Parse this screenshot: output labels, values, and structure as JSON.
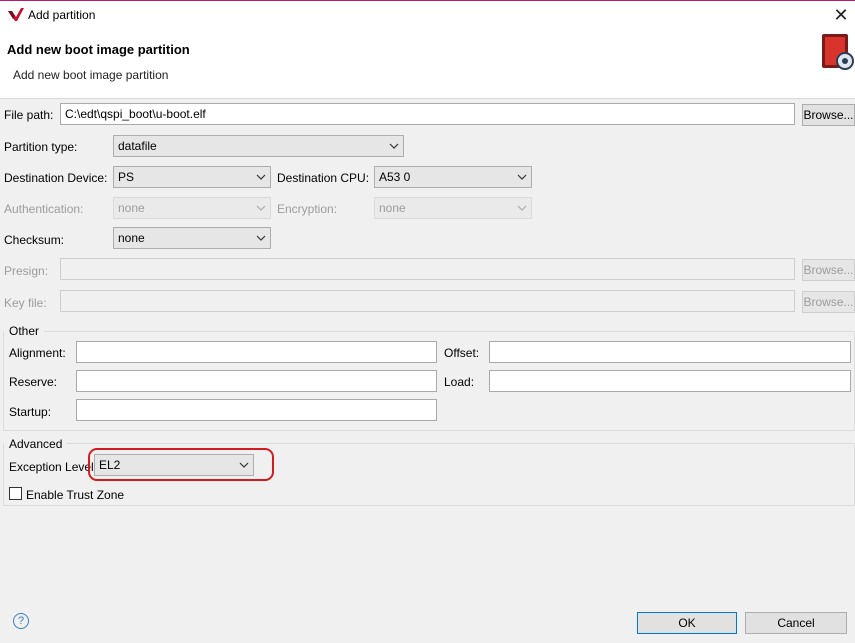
{
  "window": {
    "title": "Add partition",
    "close_label": "✕"
  },
  "header": {
    "title": "Add new boot image partition",
    "subtitle": "Add new boot image partition"
  },
  "file_path": {
    "label": "File path:",
    "value": "C:\\edt\\qspi_boot\\u-boot.elf",
    "browse_label": "Browse..."
  },
  "partition_type": {
    "label": "Partition type:",
    "value": "datafile"
  },
  "destination_device": {
    "label": "Destination Device:",
    "value": "PS"
  },
  "destination_cpu": {
    "label": "Destination CPU:",
    "value": "A53 0"
  },
  "authentication": {
    "label": "Authentication:",
    "value": "none"
  },
  "encryption": {
    "label": "Encryption:",
    "value": "none"
  },
  "checksum": {
    "label": "Checksum:",
    "value": "none"
  },
  "presign": {
    "label": "Presign:",
    "value": "",
    "browse_label": "Browse..."
  },
  "key_file": {
    "label": "Key file:",
    "value": "",
    "browse_label": "Browse..."
  },
  "other": {
    "title": "Other",
    "alignment_label": "Alignment:",
    "alignment_value": "",
    "offset_label": "Offset:",
    "offset_value": "",
    "reserve_label": "Reserve:",
    "reserve_value": "",
    "load_label": "Load:",
    "load_value": "",
    "startup_label": "Startup:",
    "startup_value": ""
  },
  "advanced": {
    "title": "Advanced",
    "exception_level_label": "Exception Level",
    "exception_level_value": "EL2",
    "trust_zone_label": "Enable Trust Zone",
    "trust_zone_checked": false
  },
  "footer": {
    "help_label": "?",
    "ok_label": "OK",
    "cancel_label": "Cancel"
  },
  "colors": {
    "title_accent": "#b31b77",
    "highlight": "#d01d22",
    "ok_border": "#0078d7",
    "logo_red": "#c8102e"
  },
  "icons": {
    "app_logo": "xilinx-logo-icon",
    "banner": "boot-image-gear-icon"
  }
}
